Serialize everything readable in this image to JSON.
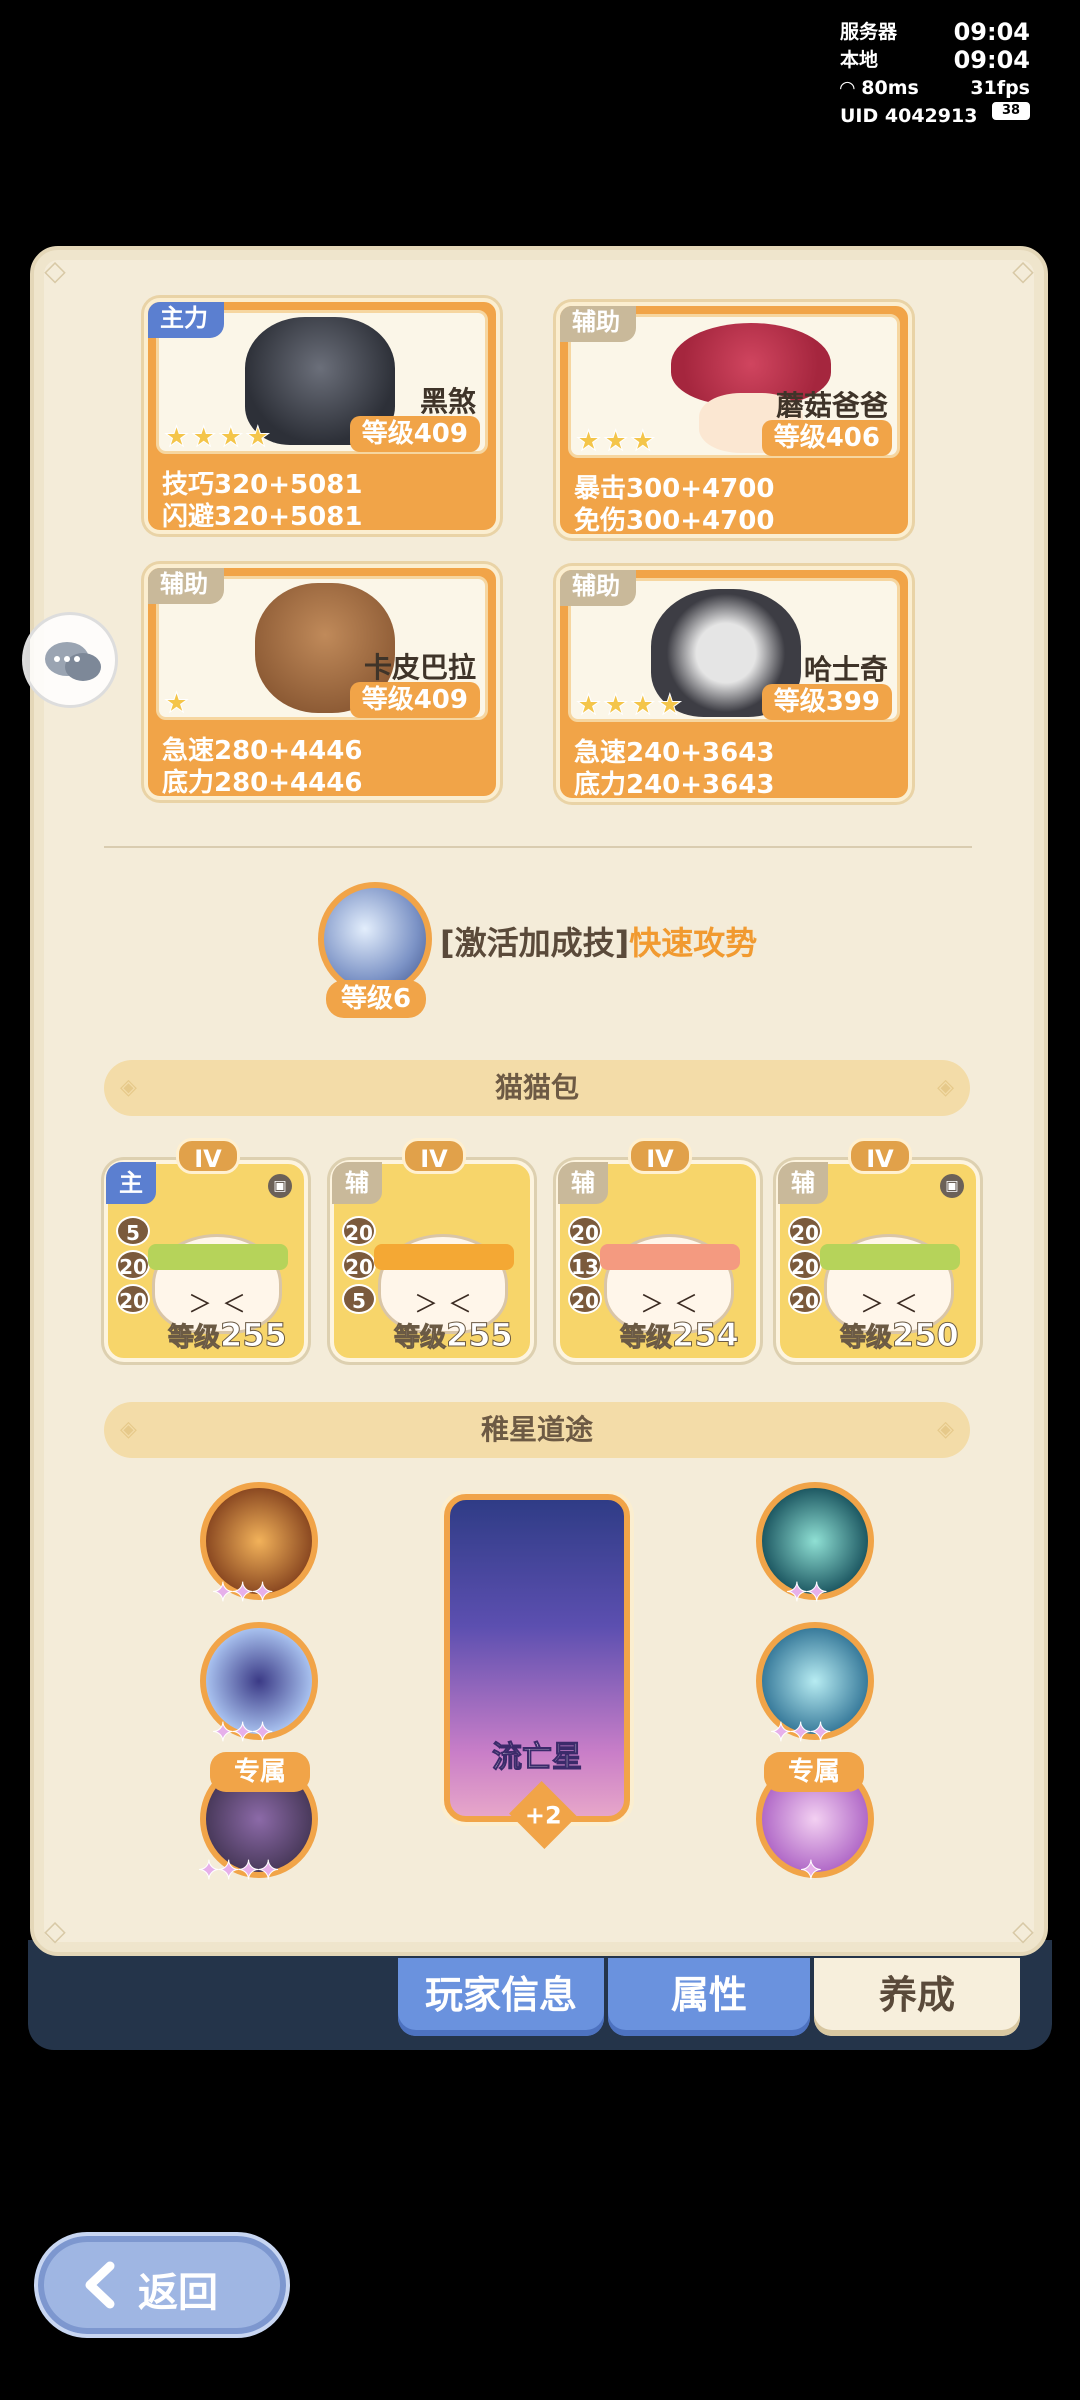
{
  "status": {
    "server_label": "服务器",
    "server_time": "09:04",
    "local_label": "本地",
    "local_time": "09:04",
    "ping": "80ms",
    "fps": "31fps",
    "uid": "UID 4042913",
    "battery": "38"
  },
  "companions": [
    {
      "role": "主力",
      "name": "黑煞",
      "level": "等级409",
      "stars": "★★★★",
      "stat1": "技巧320+5081",
      "stat2": "闪避320+5081"
    },
    {
      "role": "辅助",
      "name": "蘑菇爸爸",
      "level": "等级406",
      "stars": "★★★",
      "stat1": "暴击300+4700",
      "stat2": "免伤300+4700"
    },
    {
      "role": "辅助",
      "name": "卡皮巴拉",
      "level": "等级409",
      "stars": "★",
      "stat1": "急速280+4446",
      "stat2": "底力280+4446"
    },
    {
      "role": "辅助",
      "name": "哈士奇",
      "level": "等级399",
      "stars": "★★★★",
      "stat1": "急速240+3643",
      "stat2": "底力240+3643"
    }
  ],
  "skill": {
    "level": "等级6",
    "prefix": "[激活加成技]",
    "name": "快速攻势"
  },
  "cat_bag": {
    "title": "猫猫包",
    "items": [
      {
        "tier": "IV",
        "role": "主",
        "nums": [
          "5",
          "20",
          "20"
        ],
        "level_prefix": "等级",
        "level": "255"
      },
      {
        "tier": "IV",
        "role": "辅",
        "nums": [
          "20",
          "20",
          "5"
        ],
        "level_prefix": "等级",
        "level": "255"
      },
      {
        "tier": "IV",
        "role": "辅",
        "nums": [
          "20",
          "13",
          "20"
        ],
        "level_prefix": "等级",
        "level": "254"
      },
      {
        "tier": "IV",
        "role": "辅",
        "nums": [
          "20",
          "20",
          "20"
        ],
        "level_prefix": "等级",
        "level": "250"
      }
    ]
  },
  "star_path": {
    "title": "稚星道途",
    "exclusive_label": "专属",
    "center_name": "流亡星",
    "center_bonus": "+2",
    "left_pips": [
      "✦✦✦",
      "✦✦✦",
      "✦✦✦✦"
    ],
    "right_pips": [
      "✦✦",
      "✦✦✦",
      "✦"
    ]
  },
  "tabs": {
    "player_info": "玩家信息",
    "attributes": "属性",
    "growth": "养成"
  },
  "back_label": "返回",
  "colors": {
    "accent_orange": "#f1a448",
    "tab_blue": "#6a92de",
    "panel_bg": "#f4ecd9"
  }
}
